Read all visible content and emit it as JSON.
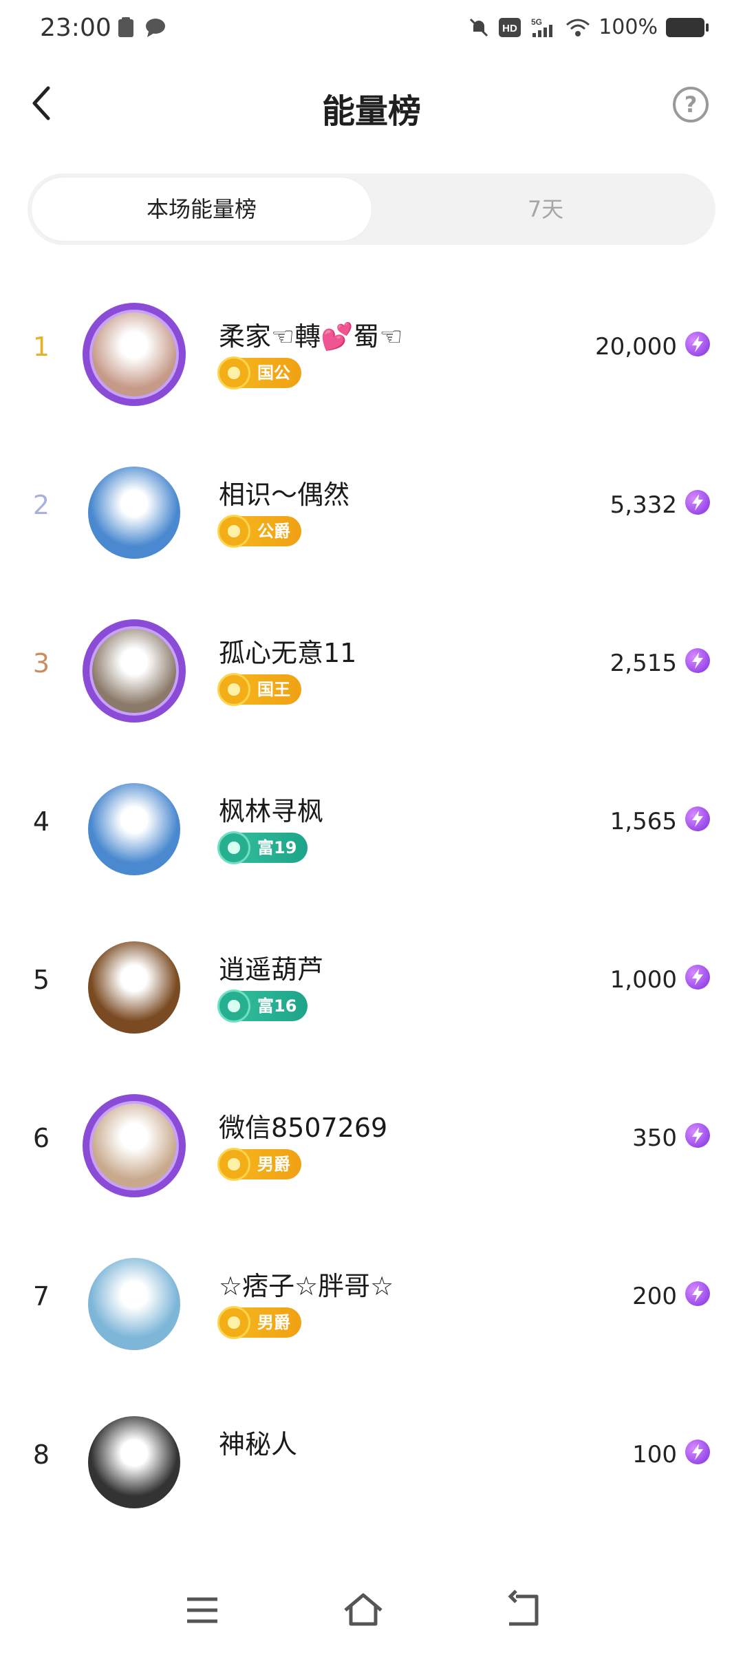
{
  "status_bar": {
    "time": "23:00",
    "battery": "100%"
  },
  "header": {
    "title": "能量榜"
  },
  "tabs": [
    {
      "label": "本场能量榜",
      "active": true
    },
    {
      "label": "7天",
      "active": false
    }
  ],
  "ranking": [
    {
      "rank": "1",
      "rank_color": "#E5B22C",
      "name": "柔家☜轉💕蜀☜",
      "badge": "国公",
      "badge_type": "gold",
      "score": "20,000",
      "avatar_color": "#c69a88",
      "frame": true
    },
    {
      "rank": "2",
      "rank_color": "#A9B1D8",
      "name": "相识～偶然",
      "badge": "公爵",
      "badge_type": "gold",
      "score": "5,332",
      "avatar_color": "#4a89cf",
      "frame": false
    },
    {
      "rank": "3",
      "rank_color": "#C98D5F",
      "name": "孤心无意11",
      "badge": "国王",
      "badge_type": "gold",
      "score": "2,515",
      "avatar_color": "#8b7a6a",
      "frame": true
    },
    {
      "rank": "4",
      "rank_color": "#222222",
      "name": "枫林寻枫",
      "badge": "富19",
      "badge_type": "green",
      "score": "1,565",
      "avatar_color": "#4a89cf",
      "frame": false
    },
    {
      "rank": "5",
      "rank_color": "#222222",
      "name": "逍遥葫芦",
      "badge": "富16",
      "badge_type": "green",
      "score": "1,000",
      "avatar_color": "#7a4a22",
      "frame": false
    },
    {
      "rank": "6",
      "rank_color": "#222222",
      "name": "微信8507269",
      "badge": "男爵",
      "badge_type": "gold",
      "score": "350",
      "avatar_color": "#c9a98c",
      "frame": true
    },
    {
      "rank": "7",
      "rank_color": "#222222",
      "name": "☆痞子☆胖哥☆",
      "badge": "男爵",
      "badge_type": "gold",
      "score": "200",
      "avatar_color": "#7eb6d8",
      "frame": false
    },
    {
      "rank": "8",
      "rank_color": "#222222",
      "name": "神秘人",
      "badge": "",
      "badge_type": "",
      "score": "100",
      "avatar_color": "#333333",
      "frame": false
    }
  ]
}
